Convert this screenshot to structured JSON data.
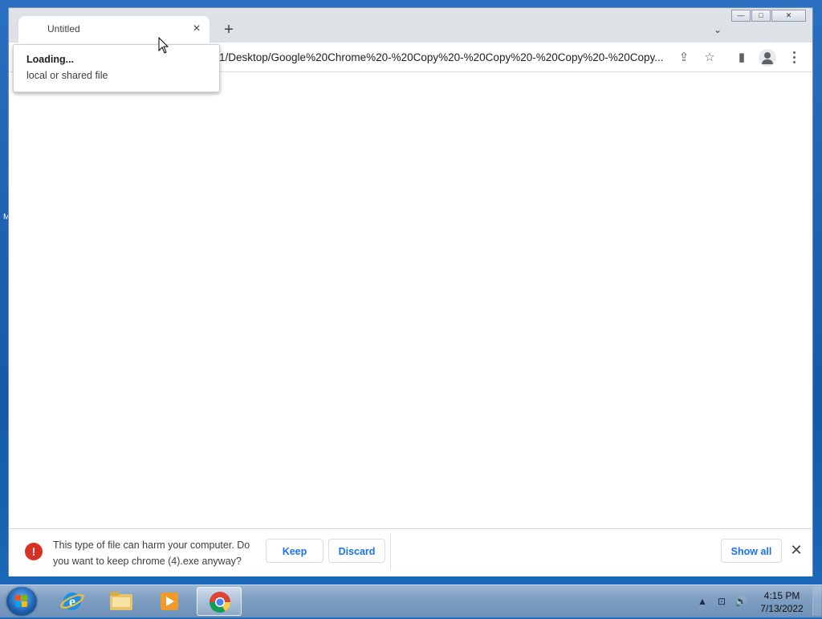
{
  "browser": {
    "tab": {
      "title": "Untitled",
      "close_icon": "×"
    },
    "new_tab_icon": "+",
    "tab_search_icon": "⌄",
    "window_controls": {
      "minimize": "—",
      "maximize": "□",
      "close": "✕"
    },
    "address_bar": {
      "url": "1/Desktop/Google%20Chrome%20-%20Copy%20-%20Copy%20-%20Copy%20-%20Copy..."
    },
    "toolbar_icons": {
      "share": "⇪",
      "bookmark": "☆",
      "side_panel": "▮"
    }
  },
  "hover_card": {
    "title": "Loading...",
    "subtitle": "local or shared file"
  },
  "download_shelf": {
    "warning_icon": "!",
    "warning_text": "This type of file can harm your computer. Do you want to keep chrome (4).exe anyway?",
    "keep_label": "Keep",
    "discard_label": "Discard",
    "show_all_label": "Show all",
    "close_icon": "✕"
  },
  "taskbar": {
    "apps": [
      "internet-explorer",
      "file-explorer",
      "media-player",
      "chrome"
    ],
    "active_app": "chrome",
    "clock": {
      "time": "4:15 PM",
      "date": "7/13/2022"
    },
    "tray_icons": {
      "expand": "▲",
      "network": "⊡",
      "volume": "🔊"
    }
  },
  "colors": {
    "accent": "#1a73e8",
    "warning": "#d93025",
    "tabstrip": "#dee1e6"
  }
}
